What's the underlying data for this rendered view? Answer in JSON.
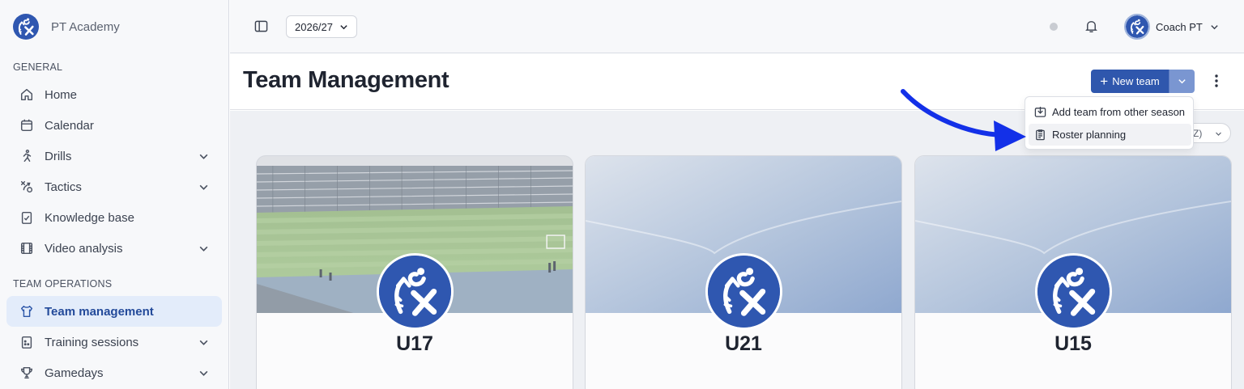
{
  "app": {
    "name": "PT Academy"
  },
  "sidebar": {
    "sections": [
      {
        "title": "GENERAL"
      },
      {
        "title": "TEAM OPERATIONS"
      }
    ],
    "items": [
      {
        "label": "Home",
        "icon": "home-icon"
      },
      {
        "label": "Calendar",
        "icon": "calendar-icon"
      },
      {
        "label": "Drills",
        "icon": "running-icon",
        "expandable": true
      },
      {
        "label": "Tactics",
        "icon": "tactics-icon",
        "expandable": true
      },
      {
        "label": "Knowledge base",
        "icon": "clipboard-check-icon"
      },
      {
        "label": "Video analysis",
        "icon": "film-icon",
        "expandable": true
      },
      {
        "label": "Team management",
        "icon": "team-shirt-icon",
        "active": true
      },
      {
        "label": "Training sessions",
        "icon": "clipboard-dice-icon",
        "expandable": true
      },
      {
        "label": "Gamedays",
        "icon": "trophy-icon",
        "expandable": true
      }
    ]
  },
  "topbar": {
    "season": "2026/27",
    "user_name": "Coach PT"
  },
  "page": {
    "title": "Team Management",
    "new_team_label": "New team",
    "sort_label": "-Z)"
  },
  "dropdown": {
    "items": [
      {
        "label": "Add team from other season",
        "icon": "import-icon"
      },
      {
        "label": "Roster planning",
        "icon": "clipboard-icon"
      }
    ]
  },
  "teams": [
    {
      "name": "U17",
      "banner": "stadium"
    },
    {
      "name": "U21",
      "banner": "gradient"
    },
    {
      "name": "U15",
      "banner": "gradient"
    }
  ],
  "colors": {
    "accent": "#2f57ad",
    "active_bg": "#e3ecfa",
    "annotation_arrow": "#1330e8"
  }
}
